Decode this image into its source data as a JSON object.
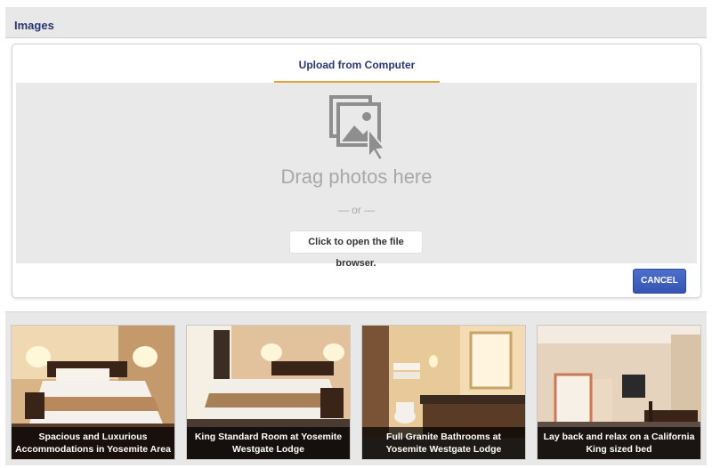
{
  "section": {
    "title": "Images"
  },
  "upload": {
    "tab_label": "Upload from Computer",
    "drag_text": "Drag photos here",
    "or_text": "— or —",
    "browse_label": "Click to open the file browser.",
    "cancel_label": "CANCEL",
    "icon": "photo-upload-icon"
  },
  "gallery": {
    "items": [
      {
        "caption": "Spacious and Luxurious Accommodations in Yosemite Area"
      },
      {
        "caption": "King Standard Room at Yosemite Westgate Lodge"
      },
      {
        "caption": "Full Granite Bathrooms at Yosemite Westgate Lodge"
      },
      {
        "caption": "Lay back and relax on a California King sized bed"
      }
    ]
  },
  "colors": {
    "title": "#2a3574",
    "tab_underline": "#e6a43a",
    "cancel_button": "#3a5bbf",
    "dropzone": "#e9e9e9"
  }
}
